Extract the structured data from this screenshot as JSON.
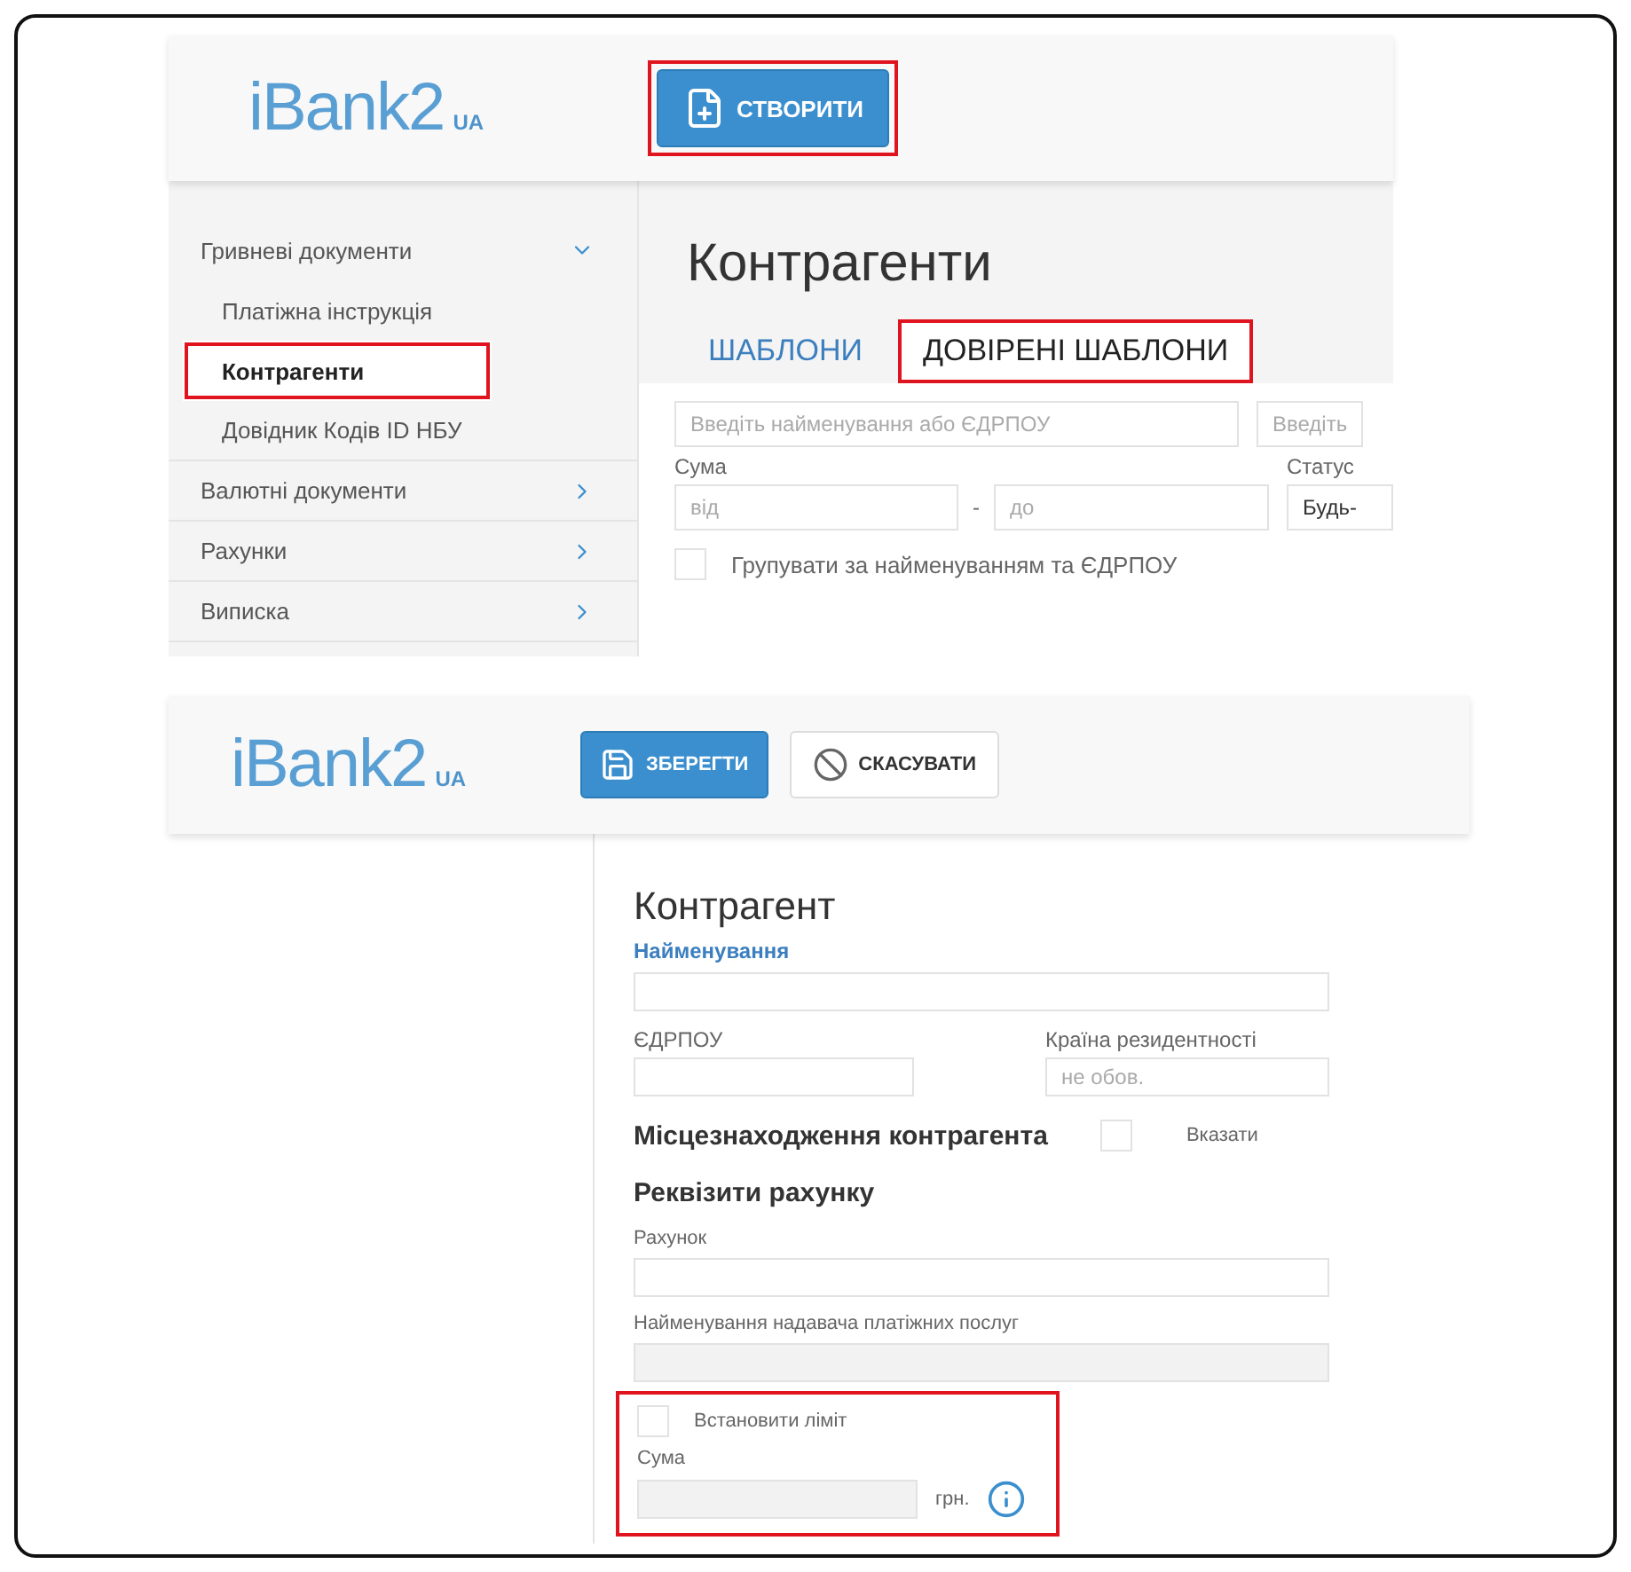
{
  "top_screen": {
    "header": {
      "logo": "iBank2",
      "logo_suffix": "UA",
      "create_button": {
        "label": "СТВОРИТИ",
        "highlighted": true
      }
    },
    "sidebar": {
      "items": [
        {
          "label": "Гривневі документи",
          "expanded": true,
          "children": [
            {
              "label": "Платіжна інструкція",
              "selected": false,
              "highlighted": false
            },
            {
              "label": "Контрагенти",
              "selected": true,
              "highlighted": true
            },
            {
              "label": "Довідник Кодів ID НБУ",
              "selected": false,
              "highlighted": false
            }
          ]
        },
        {
          "label": "Валютні документи",
          "expanded": false
        },
        {
          "label": "Рахунки",
          "expanded": false
        },
        {
          "label": "Виписка",
          "expanded": false
        }
      ]
    },
    "page_title": "Контрагенти",
    "tabs": [
      {
        "label": "ШАБЛОНИ",
        "selected": false,
        "highlighted": false
      },
      {
        "label": "ДОВІРЕНІ ШАБЛОНИ",
        "selected": true,
        "highlighted": true
      }
    ],
    "filters": {
      "search_placeholder": "Введіть найменування або ЄДРПОУ",
      "search2_placeholder": "Введіть",
      "amount_label": "Сума",
      "from_placeholder": "від",
      "separator": "-",
      "to_placeholder": "до",
      "status_label": "Статус",
      "status_value": "Будь-",
      "group_checkbox": {
        "label": "Групувати за найменуванням та ЄДРПОУ",
        "checked": false
      }
    }
  },
  "bottom_screen": {
    "header": {
      "logo": "iBank2",
      "logo_suffix": "UA",
      "save_button": "ЗБЕРЕГТИ",
      "cancel_button": "СКАСУВАТИ"
    },
    "form": {
      "title": "Контрагент",
      "name_label": "Найменування",
      "edrpou_label": "ЄДРПОУ",
      "country_label": "Країна резидентності",
      "country_placeholder": "не обов.",
      "location_heading": "Місцезнаходження контрагента",
      "location_checkbox": {
        "label": "Вказати",
        "checked": false
      },
      "account_heading": "Реквізити рахунку",
      "account_label": "Рахунок",
      "provider_label": "Найменування надавача платіжних послуг",
      "limit": {
        "highlighted": true,
        "checkbox": {
          "label": "Встановити ліміт",
          "checked": false
        },
        "amount_label": "Сума",
        "currency": "грн."
      }
    }
  }
}
